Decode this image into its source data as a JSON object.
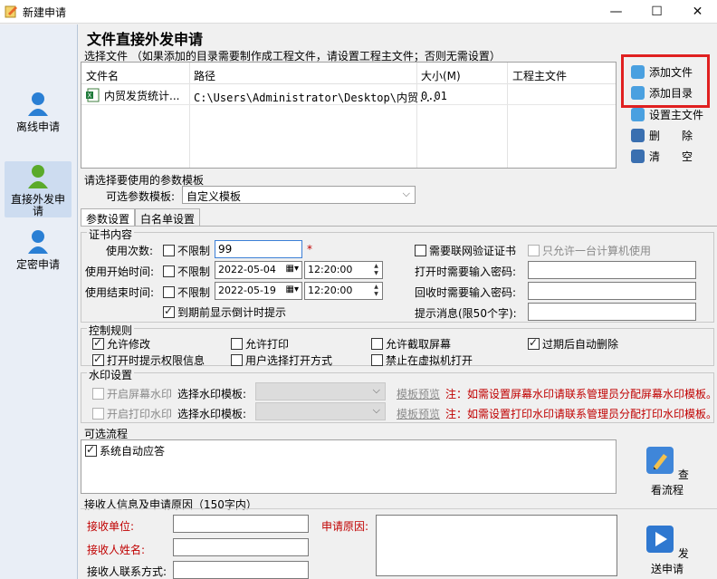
{
  "window": {
    "title": "新建申请",
    "minimize": "—",
    "maximize": "☐",
    "close": "✕"
  },
  "sidebar": {
    "items": [
      {
        "label": "离线申请"
      },
      {
        "label": "直接外发申请",
        "active": true
      },
      {
        "label": "定密申请"
      }
    ]
  },
  "page_title": "文件直接外发申请",
  "file_section": {
    "label": "选择文件 （如果添加的目录需要制作成工程文件，请设置工程主文件；否则无需设置）",
    "columns": [
      "文件名",
      "路径",
      "大小(M)",
      "工程主文件"
    ],
    "rows": [
      {
        "name": "内贸发货统计...",
        "path": "C:\\Users\\Administrator\\Desktop\\内贸...",
        "size": "0.01",
        "main": ""
      }
    ],
    "buttons": {
      "add_file": "添加文件",
      "add_dir": "添加目录",
      "set_main": "设置主文件",
      "delete": "删　　除",
      "clear": "清　　空"
    }
  },
  "template_section": {
    "label": "请选择要使用的参数模板",
    "field_label": "可选参数模板:",
    "selected": "自定义模板"
  },
  "tabs": [
    {
      "label": "参数设置",
      "active": true
    },
    {
      "label": "白名单设置"
    }
  ],
  "cert": {
    "legend": "证书内容",
    "use_count_label": "使用次数:",
    "unlimited": "不限制",
    "use_count_value": "99",
    "required_mark": "*",
    "start_label": "使用开始时间:",
    "start_date": "2022-05-04",
    "start_time": "12:20:00",
    "end_label": "使用结束时间:",
    "end_date": "2022-05-19",
    "end_time": "12:20:00",
    "countdown": "到期前显示倒计时提示",
    "need_online": "需要联网验证证书",
    "one_pc": "只允许一台计算机使用",
    "open_pwd": "打开时需要输入密码:",
    "recover_pwd": "回收时需要输入密码:",
    "hint": "提示消息(限50个字):"
  },
  "control": {
    "legend": "控制规则",
    "items": [
      {
        "label": "允许修改",
        "checked": true
      },
      {
        "label": "允许打印",
        "checked": false
      },
      {
        "label": "允许截取屏幕",
        "checked": false
      },
      {
        "label": "过期后自动删除",
        "checked": true
      },
      {
        "label": "打开时提示权限信息",
        "checked": true
      },
      {
        "label": "用户选择打开方式",
        "checked": false
      },
      {
        "label": "禁止在虚拟机打开",
        "checked": false
      }
    ]
  },
  "watermark": {
    "legend": "水印设置",
    "screen": "开启屏幕水印",
    "print": "开启打印水印",
    "choose": "选择水印模板:",
    "preview": "模板预览",
    "screen_note": "注：如需设置屏幕水印请联系管理员分配屏幕水印模板。",
    "print_note": "注：如需设置打印水印请联系管理员分配打印水印模板。"
  },
  "flow": {
    "label": "可选流程",
    "auto_reply": "系统自动应答",
    "view_flow": "查看流程"
  },
  "receiver": {
    "label": "接收人信息及申请原因（150字内）",
    "unit": "接收单位:",
    "name": "接收人姓名:",
    "contact": "接收人联系方式:",
    "reason": "申请原因:",
    "send": "发送申请"
  }
}
